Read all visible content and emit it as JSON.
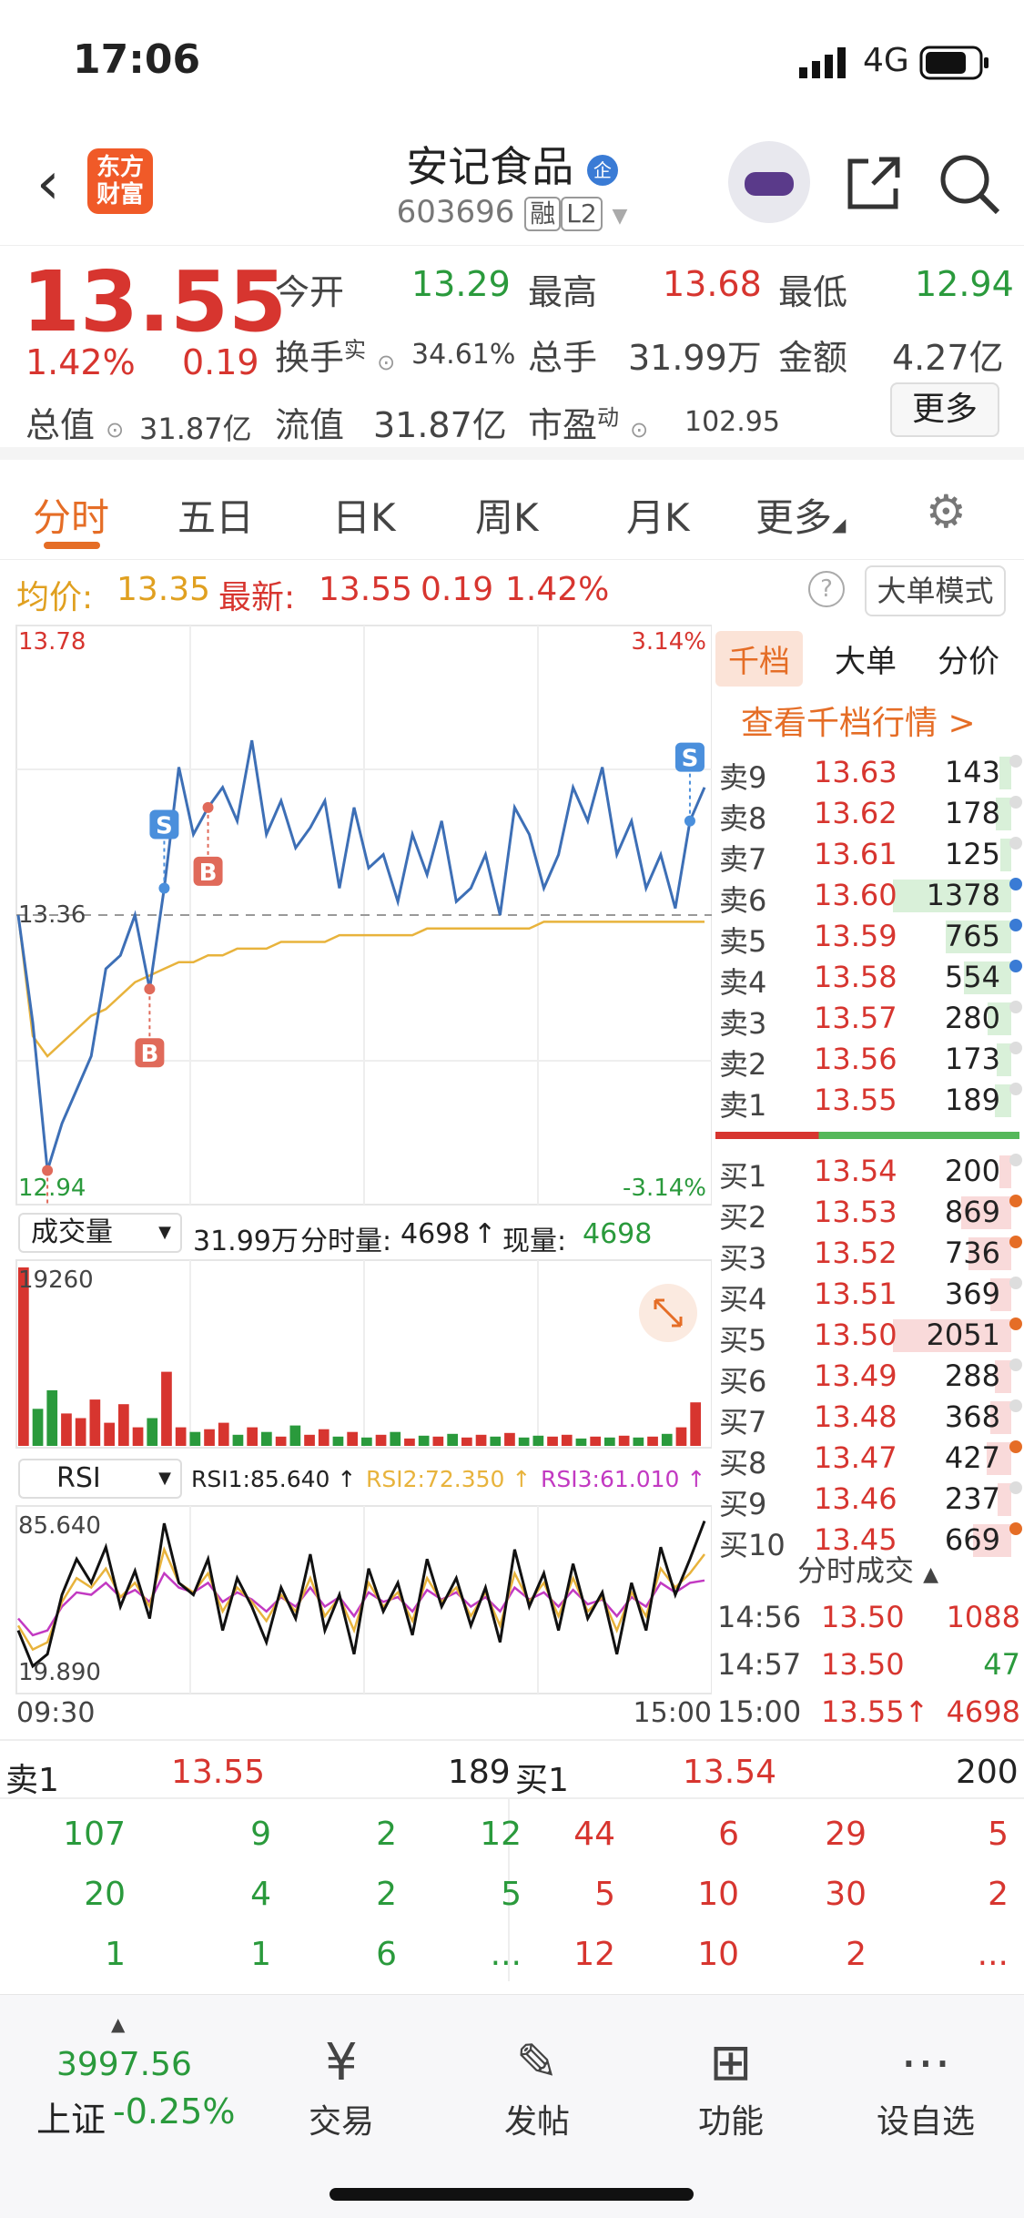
{
  "status_bar": {
    "time": "17:06",
    "network": "4G"
  },
  "header": {
    "back_icon": "chevron-left-icon",
    "logo_text_line1": "东方",
    "logo_text_line2": "财富",
    "stock_name": "安记食品",
    "badge": "企",
    "stock_code": "603696",
    "tag_rong": "融",
    "tag_l2": "L2"
  },
  "quote": {
    "price": "13.55",
    "change_pct": "1.42%",
    "change": "0.19",
    "open_label": "今开",
    "open": "13.29",
    "high_label": "最高",
    "high": "13.68",
    "low_label": "最低",
    "low": "12.94",
    "turnover_label": "换手",
    "turnover_sup": "实",
    "turnover": "34.61%",
    "volume_label": "总手",
    "volume": "31.99万",
    "amount_label": "金额",
    "amount": "4.27亿",
    "mktcap_label": "总值",
    "mktcap": "31.87亿",
    "float_label": "流值",
    "float_value": "31.87亿",
    "pe_label": "市盈",
    "pe_sup": "动",
    "pe": "102.95",
    "more_label": "更多"
  },
  "tabs": {
    "items": [
      "分时",
      "五日",
      "日K",
      "周K",
      "月K",
      "更多"
    ],
    "active": "分时"
  },
  "infobar": {
    "avg_label": "均价:",
    "avg": "13.35",
    "latest_label": "最新:",
    "latest": "13.55",
    "latest_chg": "0.19",
    "latest_pct": "1.42%",
    "bigorder_label": "大单模式",
    "help": "?"
  },
  "chart_data": [
    {
      "type": "line",
      "title": "分时",
      "x_start": "09:30",
      "x_end": "15:00",
      "y_top": "13.78",
      "y_bottom": "12.94",
      "y_ref": "13.36",
      "pct_top": "3.14%",
      "pct_bottom": "-3.14%",
      "ylim": [
        12.94,
        13.78
      ],
      "series": [
        {
          "name": "价格",
          "values": [
            13.36,
            13.2,
            12.98,
            13.05,
            13.1,
            13.15,
            13.28,
            13.3,
            13.36,
            13.25,
            13.4,
            13.58,
            13.48,
            13.52,
            13.55,
            13.5,
            13.62,
            13.48,
            13.53,
            13.46,
            13.49,
            13.53,
            13.4,
            13.52,
            13.43,
            13.45,
            13.38,
            13.48,
            13.42,
            13.5,
            13.38,
            13.4,
            13.45,
            13.36,
            13.52,
            13.48,
            13.4,
            13.45,
            13.55,
            13.5,
            13.58,
            13.45,
            13.5,
            13.4,
            13.45,
            13.37,
            13.5,
            13.55
          ]
        },
        {
          "name": "均价",
          "values": [
            13.36,
            13.18,
            13.15,
            13.17,
            13.19,
            13.21,
            13.22,
            13.24,
            13.26,
            13.27,
            13.28,
            13.29,
            13.29,
            13.3,
            13.3,
            13.31,
            13.31,
            13.31,
            13.32,
            13.32,
            13.32,
            13.32,
            13.33,
            13.33,
            13.33,
            13.33,
            13.33,
            13.33,
            13.34,
            13.34,
            13.34,
            13.34,
            13.34,
            13.34,
            13.34,
            13.34,
            13.35,
            13.35,
            13.35,
            13.35,
            13.35,
            13.35,
            13.35,
            13.35,
            13.35,
            13.35,
            13.35,
            13.35
          ]
        }
      ],
      "markers": [
        {
          "label": "B",
          "index": 2
        },
        {
          "label": "B",
          "index": 9
        },
        {
          "label": "B",
          "index": 13
        },
        {
          "label": "S",
          "index": 10
        },
        {
          "label": "S",
          "index": 46
        }
      ]
    },
    {
      "type": "bar",
      "title": "成交量",
      "header_total": "31.99万",
      "header_tick_label": "分时量:",
      "header_tick": "4698",
      "header_now_label": "现量:",
      "header_now": "4698",
      "y_top": "19260",
      "ylim": [
        0,
        19260
      ],
      "values": [
        19260,
        4000,
        6000,
        3500,
        3000,
        5000,
        2500,
        4500,
        2000,
        3000,
        8000,
        2000,
        1500,
        1800,
        2500,
        1200,
        2000,
        1500,
        1000,
        2200,
        1200,
        1800,
        1000,
        1500,
        900,
        1200,
        1500,
        800,
        1100,
        1000,
        1300,
        900,
        1200,
        1000,
        1400,
        900,
        1100,
        1000,
        1200,
        800,
        1000,
        900,
        1100,
        900,
        1000,
        1300,
        2000,
        4698
      ]
    },
    {
      "type": "line",
      "title": "RSI",
      "rsi1_label": "RSI1:85.640",
      "rsi2_label": "RSI2:72.350",
      "rsi3_label": "RSI3:61.010",
      "y_top": "85.640",
      "y_bottom": "19.890",
      "ylim": [
        19.89,
        85.64
      ],
      "series": [
        {
          "name": "RSI1",
          "values": [
            40,
            25,
            30,
            55,
            70,
            60,
            75,
            50,
            65,
            45,
            85,
            60,
            55,
            70,
            40,
            62,
            50,
            35,
            58,
            45,
            72,
            40,
            55,
            30,
            66,
            48,
            60,
            38,
            70,
            50,
            62,
            42,
            58,
            35,
            74,
            50,
            64,
            40,
            68,
            45,
            56,
            30,
            60,
            40,
            75,
            55,
            70,
            86
          ]
        },
        {
          "name": "RSI2",
          "values": [
            42,
            32,
            35,
            52,
            62,
            58,
            66,
            54,
            60,
            50,
            74,
            60,
            56,
            64,
            48,
            58,
            52,
            44,
            55,
            48,
            62,
            46,
            54,
            40,
            60,
            50,
            56,
            44,
            62,
            52,
            58,
            46,
            56,
            42,
            64,
            52,
            60,
            46,
            62,
            48,
            54,
            40,
            56,
            46,
            66,
            58,
            64,
            72
          ]
        },
        {
          "name": "RSI3",
          "values": [
            45,
            38,
            40,
            50,
            56,
            55,
            60,
            54,
            57,
            52,
            64,
            58,
            56,
            60,
            52,
            56,
            53,
            48,
            54,
            50,
            58,
            50,
            54,
            46,
            56,
            52,
            54,
            48,
            57,
            53,
            56,
            50,
            54,
            48,
            58,
            53,
            56,
            50,
            57,
            51,
            53,
            46,
            54,
            50,
            60,
            56,
            60,
            61
          ]
        }
      ]
    }
  ],
  "orderbook": {
    "tabs": [
      "千档",
      "大单",
      "分价"
    ],
    "banner": "查看千档行情 >",
    "sells": [
      {
        "label": "卖9",
        "price": "13.63",
        "vol": "143"
      },
      {
        "label": "卖8",
        "price": "13.62",
        "vol": "178"
      },
      {
        "label": "卖7",
        "price": "13.61",
        "vol": "125"
      },
      {
        "label": "卖6",
        "price": "13.60",
        "vol": "1378"
      },
      {
        "label": "卖5",
        "price": "13.59",
        "vol": "765"
      },
      {
        "label": "卖4",
        "price": "13.58",
        "vol": "554"
      },
      {
        "label": "卖3",
        "price": "13.57",
        "vol": "280"
      },
      {
        "label": "卖2",
        "price": "13.56",
        "vol": "173"
      },
      {
        "label": "卖1",
        "price": "13.55",
        "vol": "189"
      }
    ],
    "buys": [
      {
        "label": "买1",
        "price": "13.54",
        "vol": "200"
      },
      {
        "label": "买2",
        "price": "13.53",
        "vol": "869"
      },
      {
        "label": "买3",
        "price": "13.52",
        "vol": "736"
      },
      {
        "label": "买4",
        "price": "13.51",
        "vol": "369"
      },
      {
        "label": "买5",
        "price": "13.50",
        "vol": "2051"
      },
      {
        "label": "买6",
        "price": "13.49",
        "vol": "288"
      },
      {
        "label": "买7",
        "price": "13.48",
        "vol": "368"
      },
      {
        "label": "买8",
        "price": "13.47",
        "vol": "427"
      },
      {
        "label": "买9",
        "price": "13.46",
        "vol": "237"
      },
      {
        "label": "买10",
        "price": "13.45",
        "vol": "669"
      }
    ],
    "ticks_title": "分时成交",
    "ticks": [
      {
        "time": "14:56",
        "price": "13.50",
        "vol": "1088"
      },
      {
        "time": "14:57",
        "price": "13.50",
        "vol": "47"
      },
      {
        "time": "15:00",
        "price": "13.55↑",
        "vol": "4698"
      }
    ]
  },
  "bottom_table": {
    "sell_label": "卖1",
    "sell_price": "13.55",
    "sell_vol": "189",
    "buy_label": "买1",
    "buy_price": "13.54",
    "buy_vol": "200",
    "sell_rows": [
      [
        "107",
        "9",
        "2",
        "12"
      ],
      [
        "20",
        "4",
        "2",
        "5"
      ],
      [
        "1",
        "1",
        "6",
        "..."
      ]
    ],
    "buy_rows": [
      [
        "44",
        "6",
        "29",
        "5"
      ],
      [
        "5",
        "10",
        "30",
        "2"
      ],
      [
        "12",
        "10",
        "2",
        "..."
      ]
    ]
  },
  "bottom_nav": {
    "index_value": "3997.56",
    "index_name": "上证",
    "index_change": "-0.25%",
    "items": [
      {
        "label": "交易",
        "icon": "trade-icon"
      },
      {
        "label": "发帖",
        "icon": "edit-icon"
      },
      {
        "label": "功能",
        "icon": "grid-icon"
      },
      {
        "label": "设自选",
        "icon": "more-icon"
      }
    ]
  },
  "colors": {
    "up": "#d7352f",
    "down": "#2a9a3c",
    "accent": "#e56d26",
    "avg_line": "#e8b33c",
    "price_line": "#3d6fb6",
    "rsi3": "#c239c2"
  }
}
